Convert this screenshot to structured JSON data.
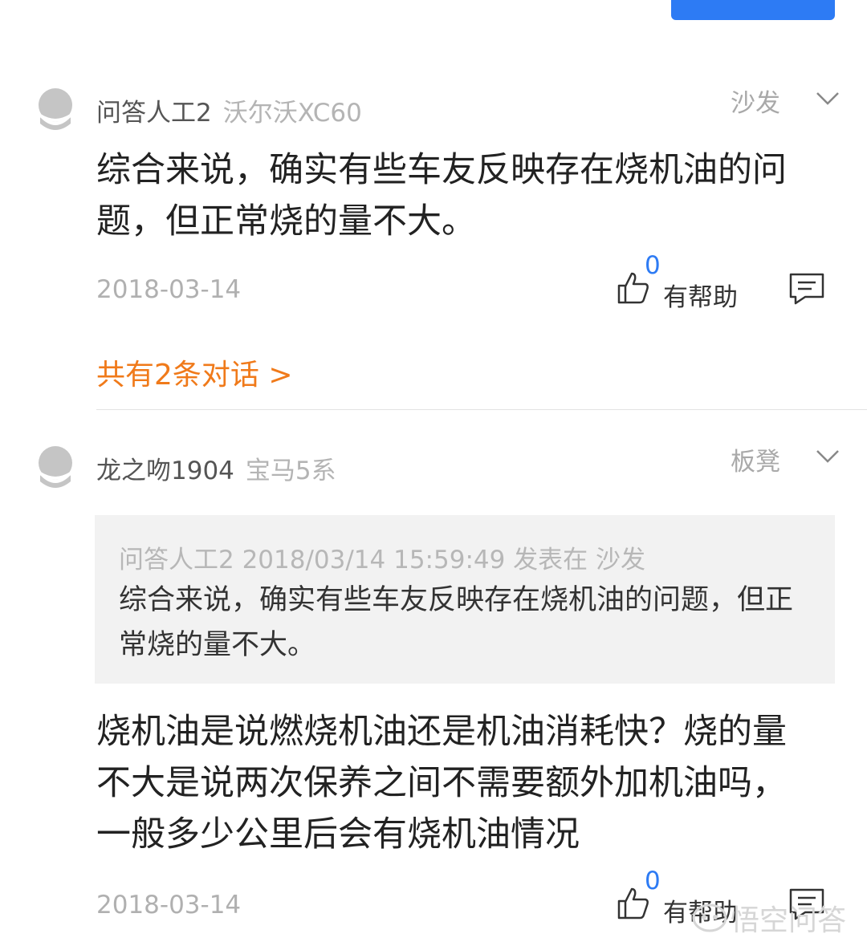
{
  "comments": [
    {
      "user": "问答人工2",
      "car": "沃尔沃XC60",
      "floor": "沙发",
      "text": "综合来说，确实有些车友反映存在烧机油的问题，但正常烧的量不大。",
      "date": "2018-03-14",
      "likes": "0",
      "helpful_label": "有帮助",
      "conversation_link": "共有2条对话 >"
    },
    {
      "user": "龙之吻1904",
      "car": "宝马5系",
      "floor": "板凳",
      "quote": {
        "meta": "问答人工2 2018/03/14 15:59:49 发表在 沙发",
        "text": "综合来说，确实有些车友反映存在烧机油的问题，但正常烧的量不大。"
      },
      "text": "烧机油是说燃烧机油还是机油消耗快？烧的量不大是说两次保养之间不需要额外加机油吗，一般多少公里后会有烧机油情况",
      "date": "2018-03-14",
      "likes": "0",
      "helpful_label": "有帮助"
    }
  ],
  "watermark": "悟空问答",
  "colors": {
    "accent": "#2d7bf4",
    "link": "#f07a1a",
    "quote_bg": "#f2f2f2"
  },
  "icons": [
    "avatar-icon",
    "chevron-down-icon",
    "thumbs-up-icon",
    "reply-icon",
    "wukong-logo-icon"
  ]
}
